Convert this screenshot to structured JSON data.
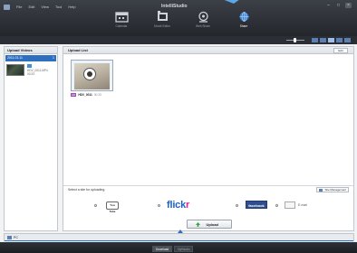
{
  "menu": {
    "items": [
      "File",
      "Edit",
      "View",
      "Tool",
      "Help"
    ],
    "app_title": "IntelliStudio",
    "controls": [
      "–",
      "□",
      "×"
    ]
  },
  "modes": [
    {
      "icon": "calendar-icon",
      "label": "Calendar",
      "active": false
    },
    {
      "icon": "film-icon",
      "label": "Movie Editor",
      "active": false
    },
    {
      "icon": "share-icon",
      "label": "Web Share",
      "active": false
    },
    {
      "icon": "globe-icon",
      "label": "Share",
      "active": true
    }
  ],
  "sidebar": {
    "title": "Upload Videos",
    "folder": {
      "label": "2011.01.11",
      "count": "1"
    },
    "file": {
      "label": "HDV_0011.MP4",
      "detail": "00:33"
    }
  },
  "main": {
    "title": "Upload List",
    "edit_label": "Edit",
    "file": {
      "type": "HD",
      "name": "HDV_0011",
      "duration": "00:33"
    },
    "select_prompt": "Select a site for uploading.",
    "site_management": "Site Management",
    "sites": {
      "youtube": "You Tube",
      "flickr_a": "flick",
      "flickr_b": "r",
      "facebook": "facebook",
      "email": "E-mail"
    },
    "upload_label": "Upload"
  },
  "status": {
    "pc_label": "PC"
  },
  "bottom": {
    "tabs": [
      {
        "label": "Download",
        "active": true
      },
      {
        "label": "MyStudio",
        "active": false
      }
    ]
  },
  "colors": {
    "accent": "#2f6fbf",
    "toolbar": "#2b2f35",
    "facebook": "#2f4d8f",
    "flickr_blue": "#1b61c4",
    "flickr_pink": "#e61c8e"
  }
}
